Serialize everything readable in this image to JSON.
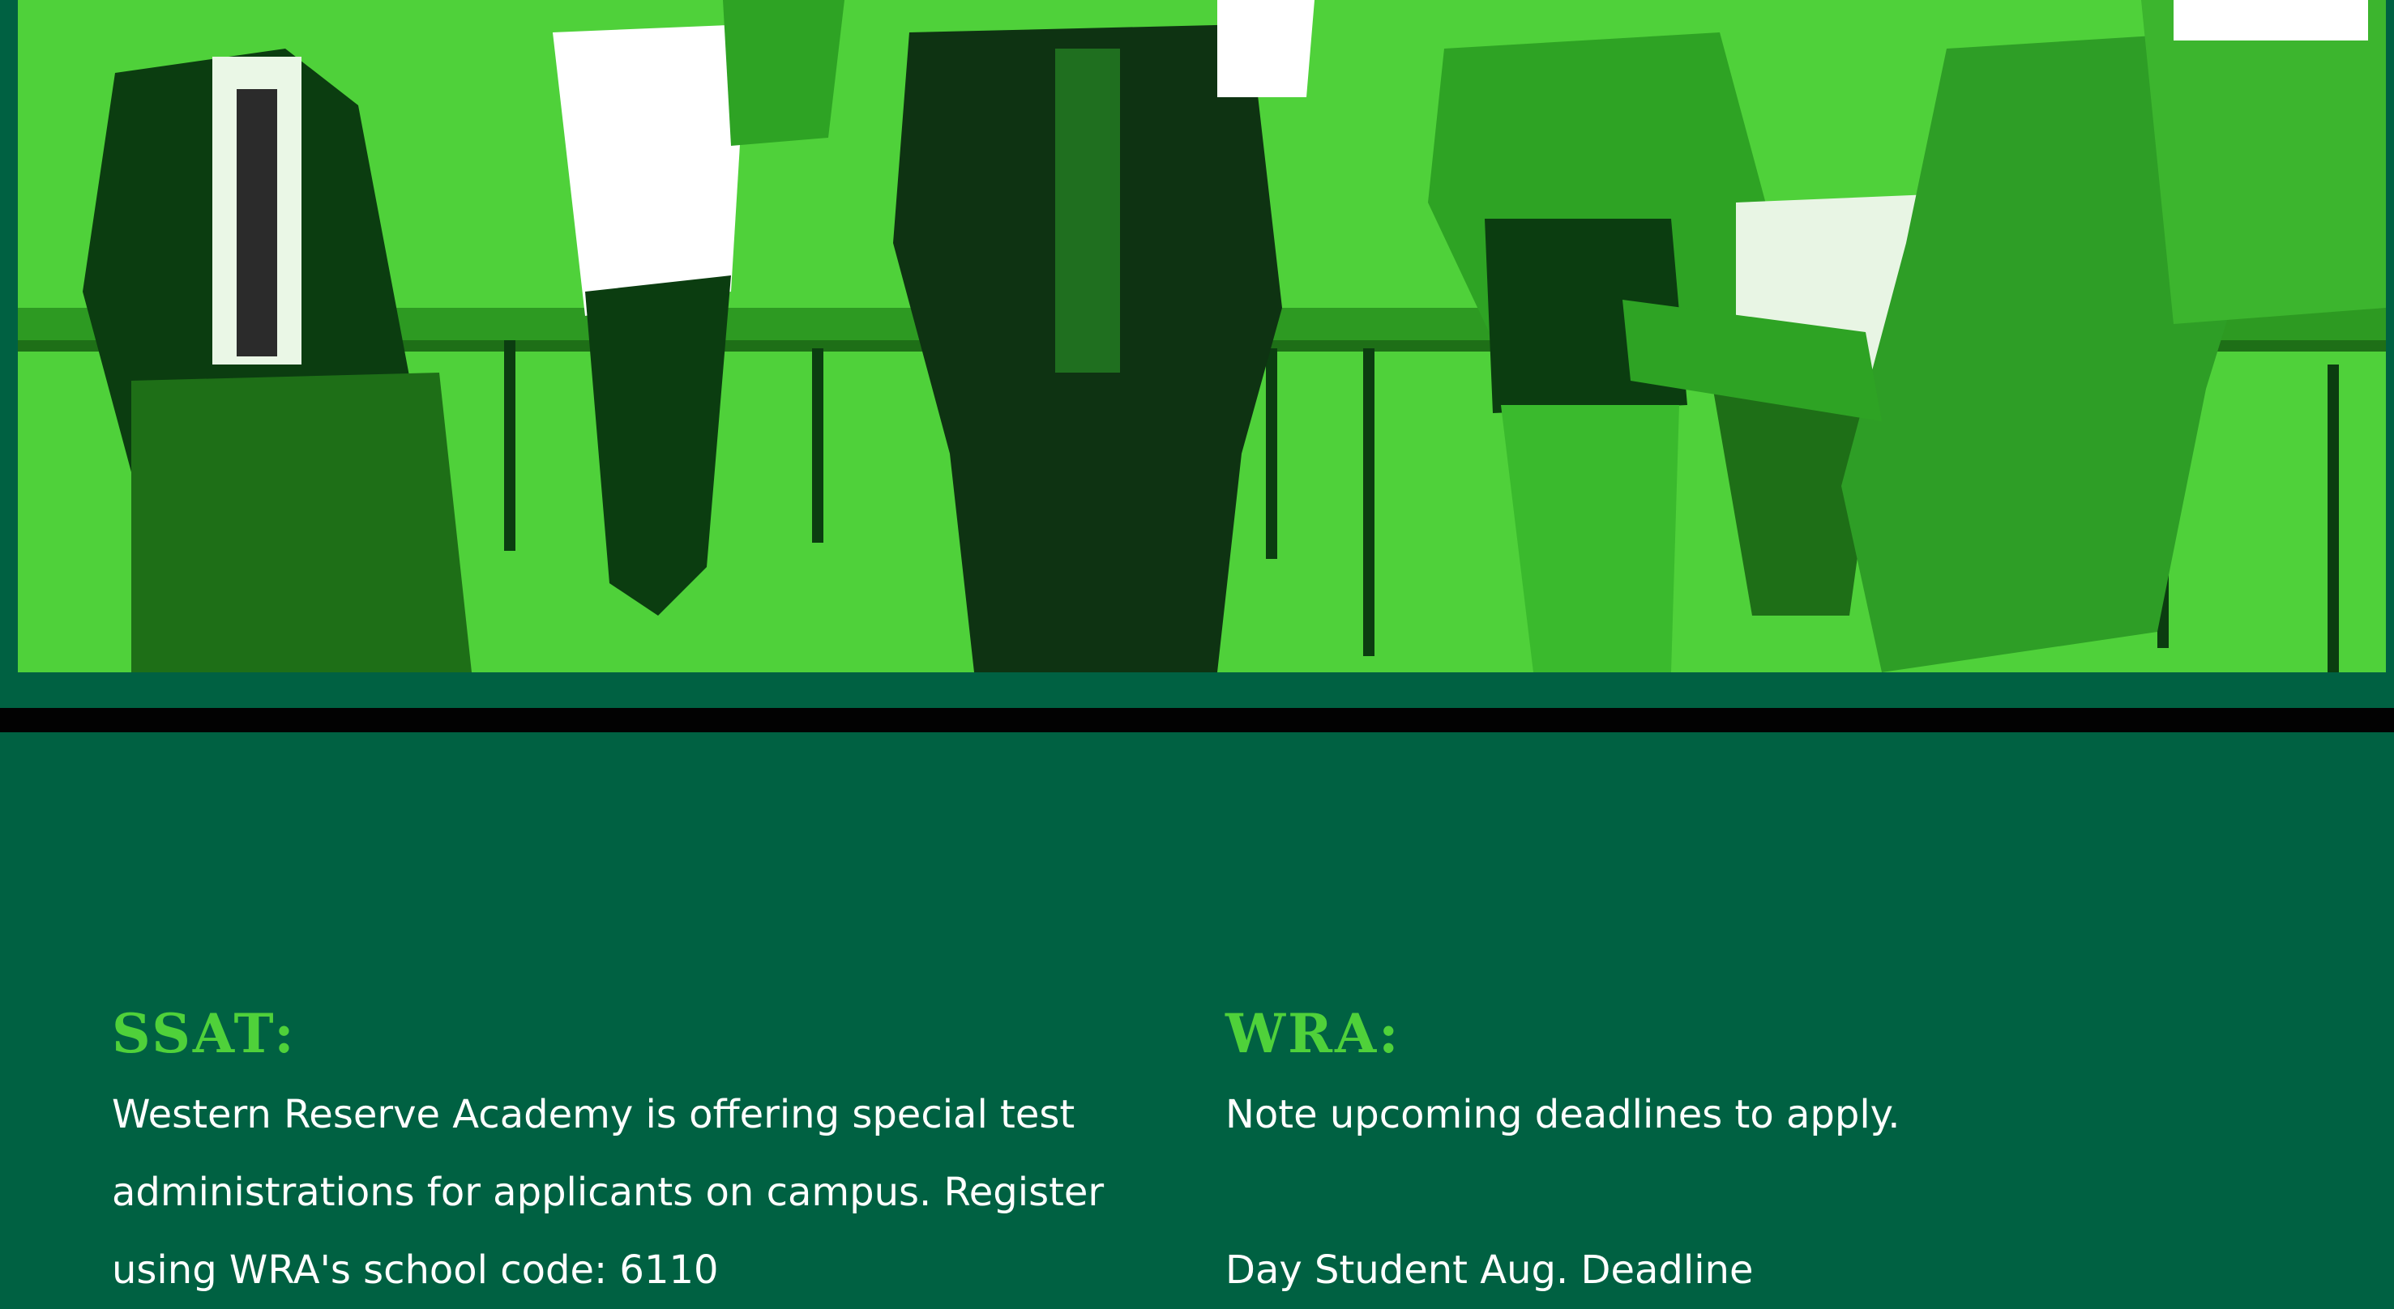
{
  "hero": {
    "image": "green-duotone-photo-people-dancing-in-classroom",
    "colors": {
      "background": "#4fd13a",
      "shadow": "#0b3d10",
      "highlight": "#ffffff"
    }
  },
  "divider_color": "#020202",
  "content_background": "#006142",
  "heading_color": "#4fd13a",
  "ssat": {
    "heading": "SSAT:",
    "lines": [
      "Western Reserve Academy is offering special test",
      "administrations for applicants on campus. Register",
      "using WRA's school code: 6110"
    ]
  },
  "wra": {
    "heading": "WRA:",
    "lines": [
      "Note upcoming deadlines to apply.",
      "Day Student Aug. Deadline"
    ]
  }
}
